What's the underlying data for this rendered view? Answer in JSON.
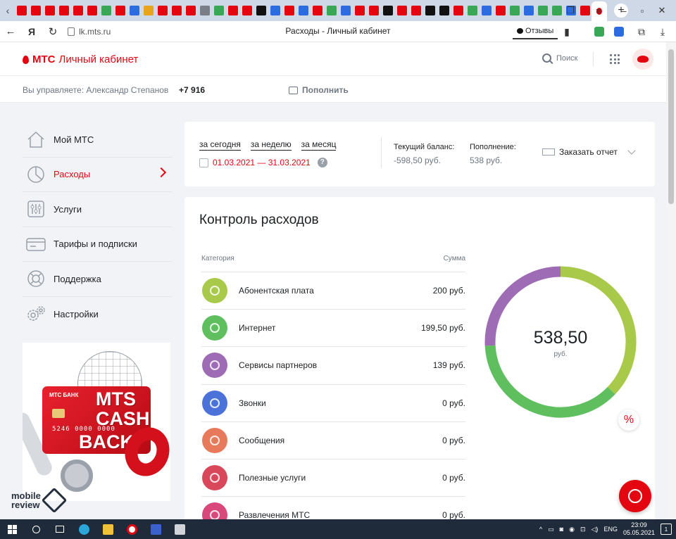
{
  "browser": {
    "url": "lk.mts.ru",
    "tab_title": "Расходы - Личный кабинет",
    "reviews_label": "Отзывы",
    "tab_icon_colors": [
      "#e30611",
      "#e30611",
      "#e30611",
      "#e30611",
      "#e30611",
      "#e30611",
      "#3aa757",
      "#e30611",
      "#2d6ce0",
      "#e8a51c",
      "#e30611",
      "#e30611",
      "#e30611",
      "#7a7f87",
      "#3aa757",
      "#e30611",
      "#e30611",
      "#111111",
      "#2d6ce0",
      "#e30611",
      "#2d6ce0",
      "#e30611",
      "#3aa757",
      "#2d6ce0",
      "#e30611",
      "#e30611",
      "#111111",
      "#e30611",
      "#e30611",
      "#111111",
      "#111111",
      "#e30611",
      "#3aa757",
      "#2d6ce0",
      "#e30611",
      "#3aa757",
      "#2d6ce0",
      "#3aa757",
      "#3aa757",
      "#2d6ce0",
      "#e30611"
    ]
  },
  "header": {
    "logo_brand": "МТС",
    "logo_title": "Личный кабинет",
    "search_label": "Поиск"
  },
  "manage": {
    "text": "Вы управляете: Александр Степанов",
    "phone": "+7 916",
    "topup_label": "Пополнить"
  },
  "sidebar": {
    "items": [
      {
        "label": "Мой МТС",
        "icon": "house-icon"
      },
      {
        "label": "Расходы",
        "icon": "chart-circle-icon",
        "active": true
      },
      {
        "label": "Услуги",
        "icon": "sliders-icon"
      },
      {
        "label": "Тарифы и подписки",
        "icon": "card-icon"
      },
      {
        "label": "Поддержка",
        "icon": "lifebuoy-icon"
      },
      {
        "label": "Настройки",
        "icon": "gears-icon"
      }
    ]
  },
  "promo": {
    "bank": "МТС БАНК",
    "card_number": "5246 0000 0000",
    "line1": "MTS",
    "line2": "CASH",
    "line3": "BACK"
  },
  "watermark": {
    "line1": "mobile",
    "line2": "review"
  },
  "period": {
    "links": [
      "за сегодня",
      "за неделю",
      "за месяц"
    ],
    "date_range": "01.03.2021 — 31.03.2021",
    "help": "?",
    "balance_label": "Текущий баланс:",
    "balance_value": "-598,50 руб.",
    "topup_label": "Пополнение:",
    "topup_value": "538 руб.",
    "report_label": "Заказать отчет"
  },
  "expenses": {
    "title": "Контроль расходов",
    "col_category": "Категория",
    "col_sum": "Сумма",
    "rows": [
      {
        "name": "Абонентская плата",
        "sum": "200 руб.",
        "color": "#a8c94a",
        "icon": "coins-icon"
      },
      {
        "name": "Интернет",
        "sum": "199,50 руб.",
        "color": "#5fbf5f",
        "icon": "globe-icon"
      },
      {
        "name": "Сервисы партнеров",
        "sum": "139 руб.",
        "color": "#9e6bb5",
        "icon": "puzzle-icon"
      },
      {
        "name": "Звонки",
        "sum": "0 руб.",
        "color": "#4a72d9",
        "icon": "phone-icon"
      },
      {
        "name": "Сообщения",
        "sum": "0 руб.",
        "color": "#e67a5a",
        "icon": "envelope-icon"
      },
      {
        "name": "Полезные услуги",
        "sum": "0 руб.",
        "color": "#d9485a",
        "icon": "wallet-icon"
      },
      {
        "name": "Развлечения МТС",
        "sum": "0 руб.",
        "color": "#d9487a",
        "icon": "umbrella-icon"
      }
    ],
    "total": "538,50",
    "total_unit": "руб.",
    "percent_label": "%"
  },
  "chart_data": {
    "type": "pie",
    "categories": [
      "Абонентская плата",
      "Интернет",
      "Сервисы партнеров"
    ],
    "values": [
      200,
      199.5,
      139
    ],
    "colors": [
      "#a8c94a",
      "#5fbf5f",
      "#9e6bb5"
    ]
  },
  "taskbar": {
    "lang": "ENG",
    "time": "23:09",
    "date": "05.05.2021",
    "notifications": "1"
  }
}
